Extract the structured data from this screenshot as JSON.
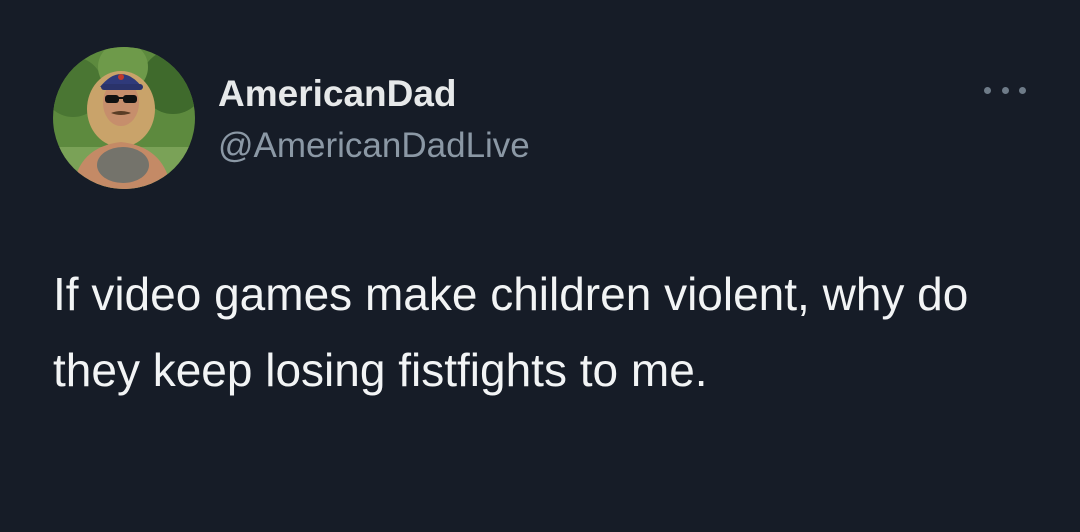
{
  "tweet": {
    "author": {
      "display_name": "AmericanDad",
      "handle": "@AmericanDadLive",
      "avatar_icon": "profile-photo-avatar"
    },
    "more_icon": "ellipsis-icon",
    "text": "If video games make children violent, why do they keep losing fistfights to me.",
    "colors": {
      "background": "#161c27",
      "primary_text": "#e7e9ea",
      "secondary_text": "#8b98a5"
    }
  }
}
